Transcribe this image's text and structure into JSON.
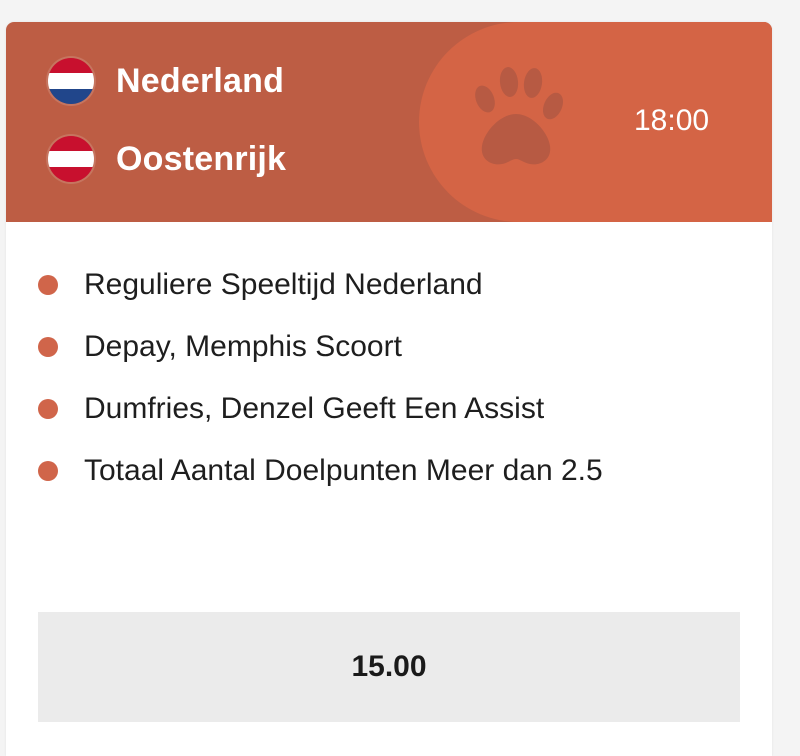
{
  "match": {
    "home_team": {
      "name": "Nederland",
      "flag_icon": "netherlands-flag-icon",
      "flag_colors": [
        "#c8102e",
        "#ffffff",
        "#21468b"
      ]
    },
    "away_team": {
      "name": "Oostenrijk",
      "flag_icon": "austria-flag-icon",
      "flag_colors": [
        "#c8102e",
        "#ffffff",
        "#c8102e"
      ]
    },
    "time": "18:00",
    "header_icon": "paw-icon"
  },
  "selections": [
    {
      "label": "Reguliere Speeltijd Nederland"
    },
    {
      "label": "Depay, Memphis Scoort"
    },
    {
      "label": "Dumfries, Denzel Geeft Een Assist"
    },
    {
      "label": "Totaal Aantal Doelpunten Meer dan 2.5"
    }
  ],
  "odds": {
    "value": "15.00"
  },
  "colors": {
    "header_bg": "#bd5d44",
    "header_accent": "#d46445",
    "bullet": "#d0654a",
    "odds_bg": "#ebebeb"
  }
}
